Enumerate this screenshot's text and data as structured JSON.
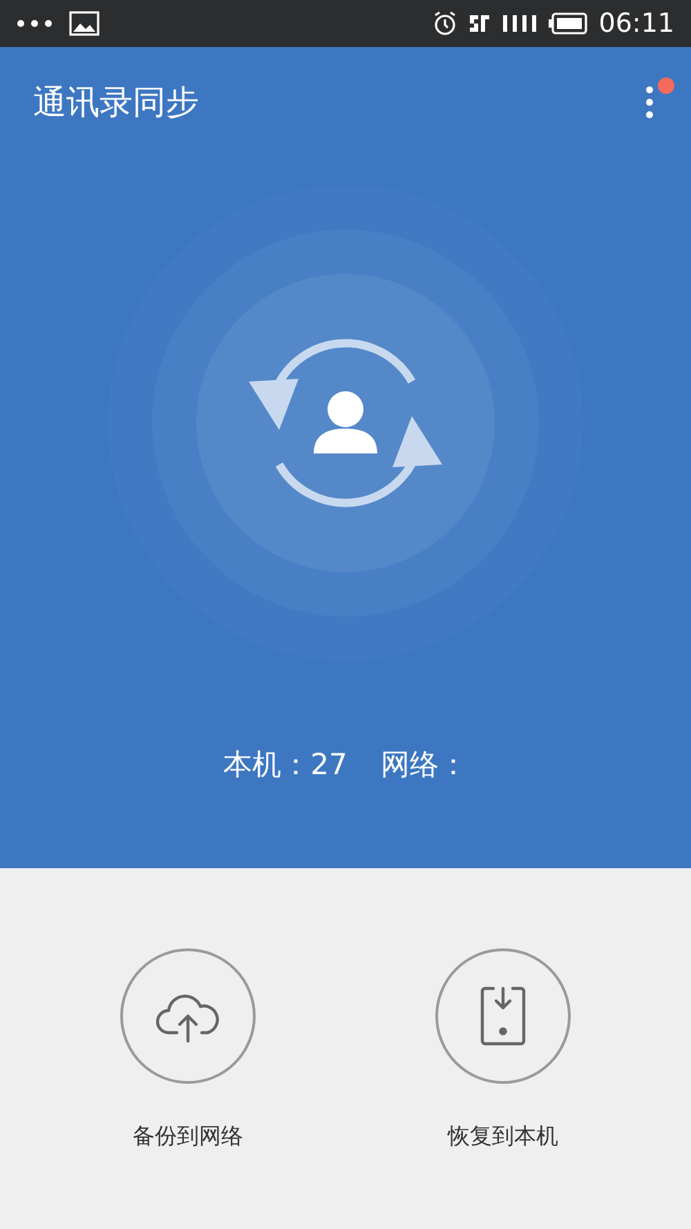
{
  "status_bar": {
    "time": "06:11"
  },
  "header": {
    "title": "通讯录同步",
    "menu_notification": true
  },
  "counts": [
    {
      "label": "本机：27"
    },
    {
      "label": "网络："
    }
  ],
  "actions": [
    {
      "kind": "upload",
      "label": "备份到网络"
    },
    {
      "kind": "download",
      "label": "恢复到本机"
    }
  ]
}
